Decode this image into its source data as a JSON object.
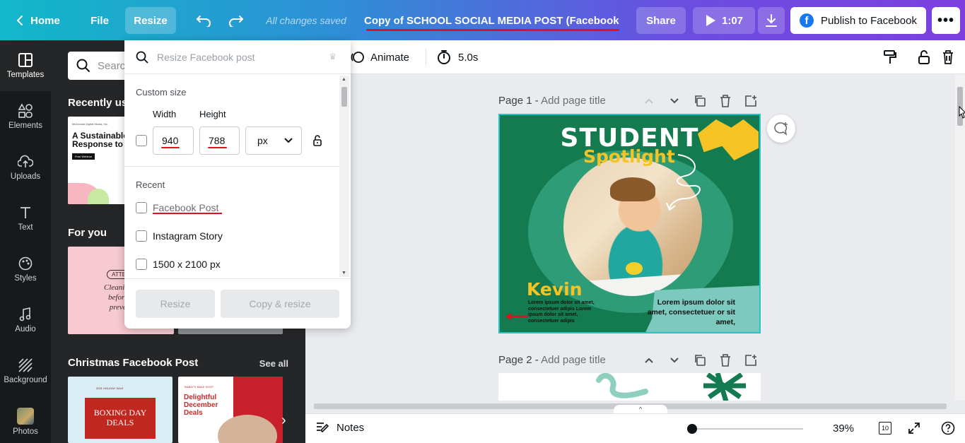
{
  "topbar": {
    "home": "Home",
    "file": "File",
    "resize": "Resize",
    "saved_status": "All changes saved",
    "title": "Copy of  SCHOOL SOCIAL MEDIA POST (Facebook Po...",
    "share": "Share",
    "duration": "1:07",
    "publish": "Publish to Facebook",
    "colors": {
      "gradient_start": "#12b8c9",
      "gradient_end": "#7d3fe0",
      "annotation_red": "#e0101e"
    }
  },
  "rail": {
    "items": [
      {
        "label": "Templates",
        "icon": "templates-icon",
        "active": true
      },
      {
        "label": "Elements",
        "icon": "elements-icon"
      },
      {
        "label": "Uploads",
        "icon": "uploads-icon"
      },
      {
        "label": "Text",
        "icon": "text-icon"
      },
      {
        "label": "Styles",
        "icon": "styles-icon"
      },
      {
        "label": "Audio",
        "icon": "audio-icon"
      },
      {
        "label": "Background",
        "icon": "background-icon"
      },
      {
        "label": "Photos",
        "icon": "photos-avatar"
      }
    ]
  },
  "panel": {
    "search_placeholder": "Search",
    "recently_used": "Recently us",
    "for_you": "For you",
    "christmas": "Christmas Facebook Post",
    "see_all": "See all",
    "thumbs": {
      "webinar_small": "McDonald Digital Media, Inc.",
      "webinar_title": "A Sustainable Response to COVID-19",
      "webinar_pill": "Free Webinar",
      "pink_attn": "ATTEN",
      "pink_text": [
        "Cleaning y",
        "before b",
        "prevent"
      ],
      "boxing_small": "2021 HOLIDAY SALE",
      "boxing_title": "BOXING DAY DEALS",
      "dec_small": "TAMMY'S BAKE SHOP",
      "dec_title": "Delightful December Deals"
    }
  },
  "resize_popover": {
    "search_placeholder": "Resize Facebook post",
    "custom_size": "Custom size",
    "width_label": "Width",
    "height_label": "Height",
    "width_value": "940",
    "height_value": "788",
    "unit": "px",
    "recent_label": "Recent",
    "recent_items": [
      "Facebook Post",
      "Instagram Story",
      "1500 x 2100 px"
    ],
    "resize_button": "Resize",
    "copy_resize_button": "Copy & resize"
  },
  "editor_toolbar": {
    "animate": "Animate",
    "duration": "5.0s"
  },
  "pages": [
    {
      "label": "Page 1",
      "title_placeholder": "Add page title"
    },
    {
      "label": "Page 2",
      "title_placeholder": "Add page title"
    }
  ],
  "design": {
    "heading": "STUDENT",
    "subheading": "Spotlight",
    "name": "Kevin",
    "lorem_left": "Lorem ipsum dolor sit amet, consectetuer adipis Lorem ipsum dolor sit amet, consectetuer adipis",
    "lorem_right": "Lorem ipsum dolor sit amet, consectetuer or sit amet,",
    "colors": {
      "bg": "#137b4f",
      "yellow": "#f6c325",
      "teal": "#7cc9be"
    }
  },
  "bottombar": {
    "notes": "Notes",
    "zoom": "39%",
    "page_count": "10",
    "zoom_level": 0.0
  }
}
